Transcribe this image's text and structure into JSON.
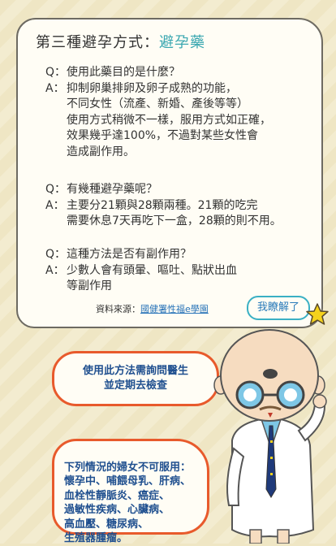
{
  "title": {
    "main": "第三種避孕方式：",
    "accent": "避孕藥"
  },
  "qa": [
    {
      "q_label": "Q：",
      "q": "使用此藥目的是什麼？",
      "a_label": "A：",
      "a": "抑制卵巢排卵及卵子成熟的功能，\n不同女性（流產、新婚、產後等等）\n使用方式稍微不一樣，服用方式如正確，\n效果幾乎達100%，不過對某些女性會\n造成副作用。"
    },
    {
      "q_label": "Q：",
      "q": "有幾種避孕藥呢？",
      "a_label": "A：",
      "a": "主要分21顆與28顆兩種。21顆的吃完\n需要休息7天再吃下一盒，28顆的則不用。"
    },
    {
      "q_label": "Q：",
      "q": "這種方法是否有副作用？",
      "a_label": "A：",
      "a": "少數人會有頭暈、嘔吐、點狀出血\n等副作用"
    }
  ],
  "source": {
    "label": "資料來源：",
    "link": "國健署性福e學園"
  },
  "got_it_button": "我瞭解了",
  "bubble_consult": "使用此方法需詢問醫生\n並定期去檢查",
  "bubble_warning": "下列情況的婦女不可服用：\n懷孕中、哺餵母乳、肝病、\n血栓性靜脈炎、癌症、\n過敏性疾病、心臟病、\n高血壓、糖尿病、\n生殖器腫瘤。",
  "colors": {
    "accent": "#39a7b0",
    "bubble_border": "#e85a2c",
    "bubble_text": "#1f4f8f",
    "link": "#2672b8"
  }
}
